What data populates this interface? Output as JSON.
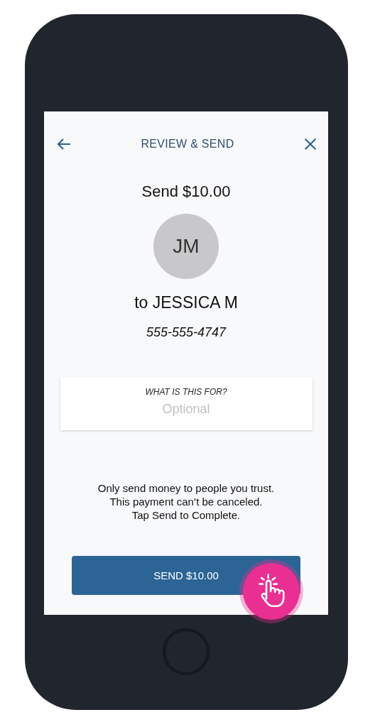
{
  "header": {
    "title": "REVIEW & SEND"
  },
  "amount_title": "Send $10.00",
  "recipient": {
    "initials": "JM",
    "name": "to JESSICA M",
    "phone": "555-555-4747"
  },
  "memo_field": {
    "label": "WHAT IS THIS FOR?",
    "placeholder": "Optional"
  },
  "notice": "Only send money to people you trust.\nThis payment can’t be canceled.\nTap Send to Complete.",
  "send_button": {
    "label": "SEND $10.00"
  }
}
